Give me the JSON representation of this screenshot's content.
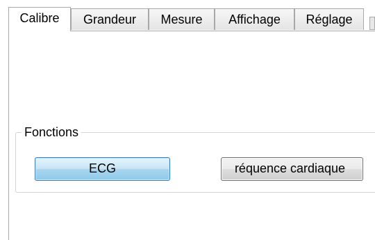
{
  "tabs": [
    {
      "label": "Calibre",
      "active": true
    },
    {
      "label": "Grandeur",
      "active": false
    },
    {
      "label": "Mesure",
      "active": false
    },
    {
      "label": "Affichage",
      "active": false
    },
    {
      "label": "Réglage",
      "active": false
    }
  ],
  "group": {
    "legend": "Fonctions",
    "buttons": [
      {
        "label": "ECG"
      },
      {
        "label": "réquence cardiaque"
      }
    ]
  },
  "colors": {
    "accent_button": "#8fcaea",
    "border": "#a8a8a8"
  }
}
